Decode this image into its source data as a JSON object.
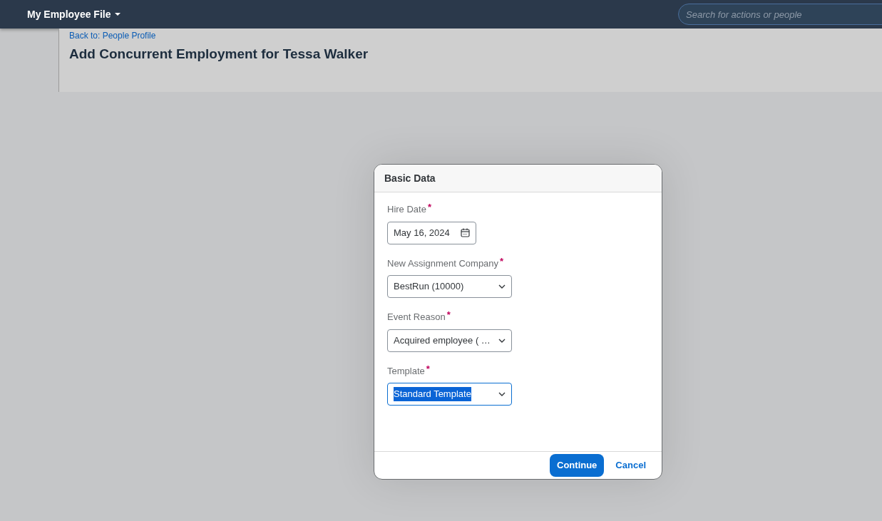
{
  "top_bar": {
    "menu_title": "My Employee File",
    "search": {
      "placeholder": "Search for actions or people"
    }
  },
  "header": {
    "back_link": "Back to: People Profile",
    "title": "Add Concurrent Employment for Tessa Walker"
  },
  "dialog": {
    "title": "Basic Data",
    "fields": [
      {
        "kind": "date",
        "label": "Hire Date",
        "required_mark": "*",
        "value": "May 16, 2024",
        "highlighted": false
      },
      {
        "kind": "select",
        "label": "New Assignment Company",
        "required_mark": "*",
        "value": "BestRun (10000)",
        "highlighted": false
      },
      {
        "kind": "select",
        "label": "Event Reason",
        "required_mark": "*",
        "value": "Acquired employee ( …",
        "highlighted": false
      },
      {
        "kind": "select",
        "label": "Template",
        "required_mark": "*",
        "value": "Standard Template",
        "highlighted": true
      }
    ],
    "buttons": [
      {
        "kind": "primary",
        "label": "Continue"
      },
      {
        "kind": "link",
        "label": "Cancel"
      }
    ]
  }
}
